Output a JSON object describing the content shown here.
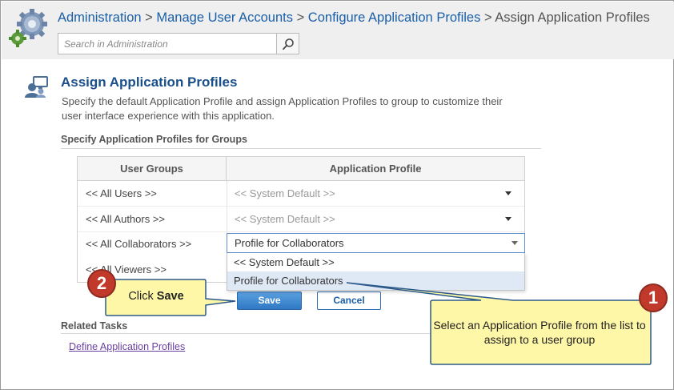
{
  "header": {
    "breadcrumb": [
      "Administration",
      "Manage User Accounts",
      "Configure Application Profiles"
    ],
    "breadcrumb_separator": ">",
    "current": "Assign Application Profiles",
    "search": {
      "placeholder": "Search in Administration",
      "value": ""
    }
  },
  "page": {
    "title": "Assign Application Profiles",
    "description": "Specify the default Application Profile and assign Application Profiles to group to customize their user interface experience with this application.",
    "section_title": "Specify Application Profiles for Groups"
  },
  "table": {
    "columns": [
      "User Groups",
      "Application Profile"
    ],
    "rows": [
      {
        "group": "<< All Users >>",
        "profile": "<< System Default >>"
      },
      {
        "group": "<< All Authors >>",
        "profile": "<< System Default >>"
      },
      {
        "group": "<< All Collaborators >>",
        "profile": "Profile for Collaborators"
      },
      {
        "group": "<< All Viewers >>",
        "profile": ""
      }
    ],
    "dropdown_options": [
      "<< System Default >>",
      "Profile for Collaborators"
    ],
    "dropdown_selected": "Profile for Collaborators"
  },
  "buttons": {
    "save": "Save",
    "cancel": "Cancel"
  },
  "related": {
    "title": "Related Tasks",
    "link": "Define Application Profiles"
  },
  "callouts": {
    "one": {
      "number": "1",
      "text": "Select an Application Profile from the list to assign to a user group"
    },
    "two": {
      "number": "2",
      "prefix": "Click",
      "bold": "Save"
    }
  },
  "colors": {
    "link": "#1a5fa8",
    "title": "#1a4f8a",
    "callout_fill": "#fff7a8",
    "callout_border": "#2b5a8a",
    "badge": "#c0392b",
    "visited_link": "#6b3fa0"
  }
}
